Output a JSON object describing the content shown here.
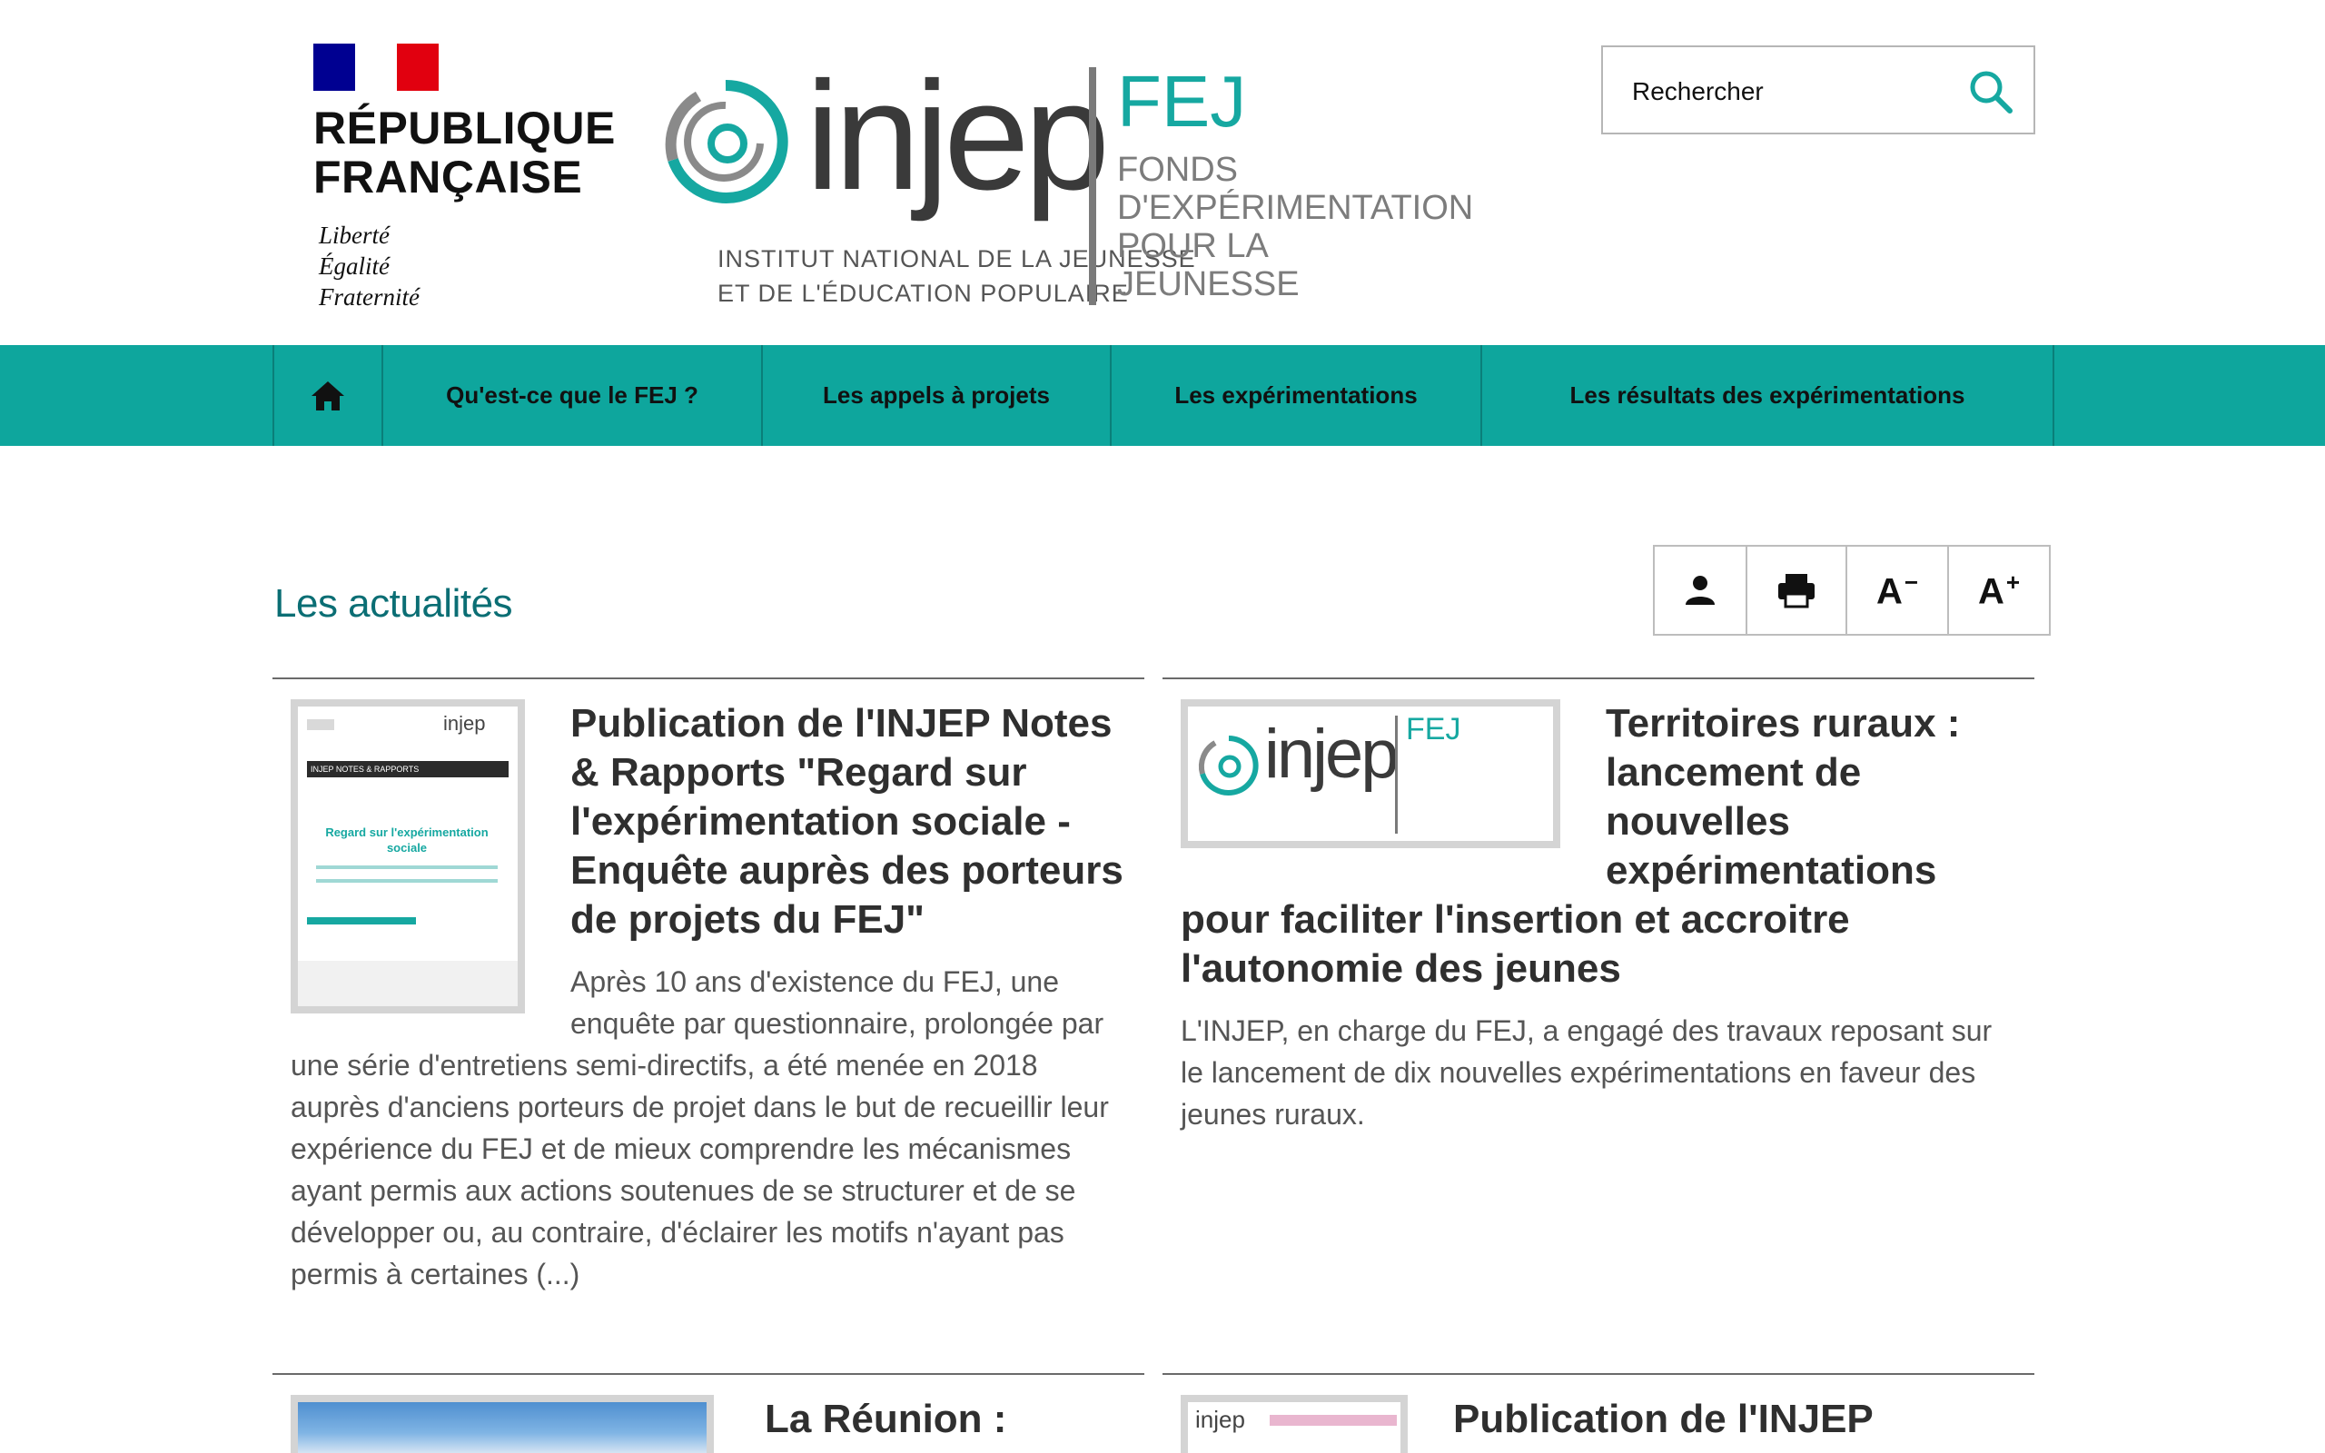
{
  "header": {
    "republique": {
      "line1": "RÉPUBLIQUE",
      "line2": "FRANÇAISE",
      "motto": [
        "Liberté",
        "Égalité",
        "Fraternité"
      ]
    },
    "injep_logo": {
      "word": "injep",
      "subtitle_line1": "INSTITUT NATIONAL DE LA JEUNESSE",
      "subtitle_line2": "ET DE L'ÉDUCATION POPULAIRE",
      "fej": "FEJ",
      "fej_sub": [
        "FONDS",
        "D'EXPÉRIMENTATION",
        "POUR LA",
        "JEUNESSE"
      ]
    },
    "search": {
      "placeholder": "Rechercher",
      "icon": "search-icon"
    }
  },
  "nav": {
    "home_icon": "home-icon",
    "items": [
      {
        "label": "Qu'est-ce que le FEJ ?"
      },
      {
        "label": "Les appels à projets"
      },
      {
        "label": "Les expérimentations"
      },
      {
        "label": "Les résultats des expérimentations"
      }
    ]
  },
  "section": {
    "title": "Les actualités",
    "tools": [
      {
        "icon": "user-icon"
      },
      {
        "icon": "print-icon"
      },
      {
        "label": "A",
        "sup": "−",
        "icon": "decrease-font-icon"
      },
      {
        "label": "A",
        "sup": "+",
        "icon": "increase-font-icon"
      }
    ]
  },
  "cards": [
    {
      "title": "Publication de l'INJEP Notes & Rapports \"Regard sur l'expérimentation sociale - Enquête auprès des porteurs de projets du FEJ\"",
      "text": "Après 10 ans d'existence du FEJ, une enquête par questionnaire, prolongée par une série d'entretiens semi-directifs, a été menée en 2018 auprès d'anciens porteurs de projet dans le but de recueillir leur expérience du FEJ et de mieux comprendre les mécanismes ayant permis aux actions soutenues de se structurer et de se développer ou, au contraire, d'éclairer les motifs n'ayant pas permis à certaines (...)",
      "thumb": {
        "header_word": "injep",
        "band": "INJEP NOTES & RAPPORTS",
        "title": "Regard sur l'expérimentation sociale"
      }
    },
    {
      "title": "Territoires ruraux : lancement de nouvelles expérimentations pour faciliter l'insertion et accroitre l'autonomie des jeunes",
      "text": "L'INJEP, en charge du FEJ, a engagé des travaux reposant sur le lancement de dix nouvelles expérimentations en faveur des jeunes ruraux.",
      "thumb": {
        "word": "injep",
        "fej": "FEJ"
      }
    },
    {
      "title": "La Réunion :"
    },
    {
      "title": "Publication de l'INJEP",
      "thumb": {
        "word": "injep"
      }
    }
  ],
  "colors": {
    "accent": "#0ea69d",
    "title": "#0b6e74",
    "flag_blue": "#000091",
    "flag_red": "#e1000f"
  }
}
